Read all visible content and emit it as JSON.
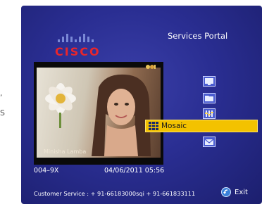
{
  "edge": {
    "comma": ",",
    "s": "S"
  },
  "header": {
    "title": "Services Portal",
    "logo_text": "CISCO"
  },
  "video": {
    "caption": "Minisha Lamba",
    "channel_logo": ""
  },
  "menu": {
    "selected_label": "Mosaic",
    "icons": [
      "tv-icon",
      "folder-icon",
      "settings-icon",
      "mosaic-icon",
      "mail-icon"
    ]
  },
  "status": {
    "channel": "004–9X",
    "datetime": "04/06/2011 05:56"
  },
  "footer": {
    "customer_service": "Customer Service :  + 91-66183000sqi + 91-661833111",
    "exit_label": "Exit"
  },
  "colors": {
    "background": "#2a2e92",
    "highlight": "#f3c200",
    "logo_red": "#e8262c"
  }
}
